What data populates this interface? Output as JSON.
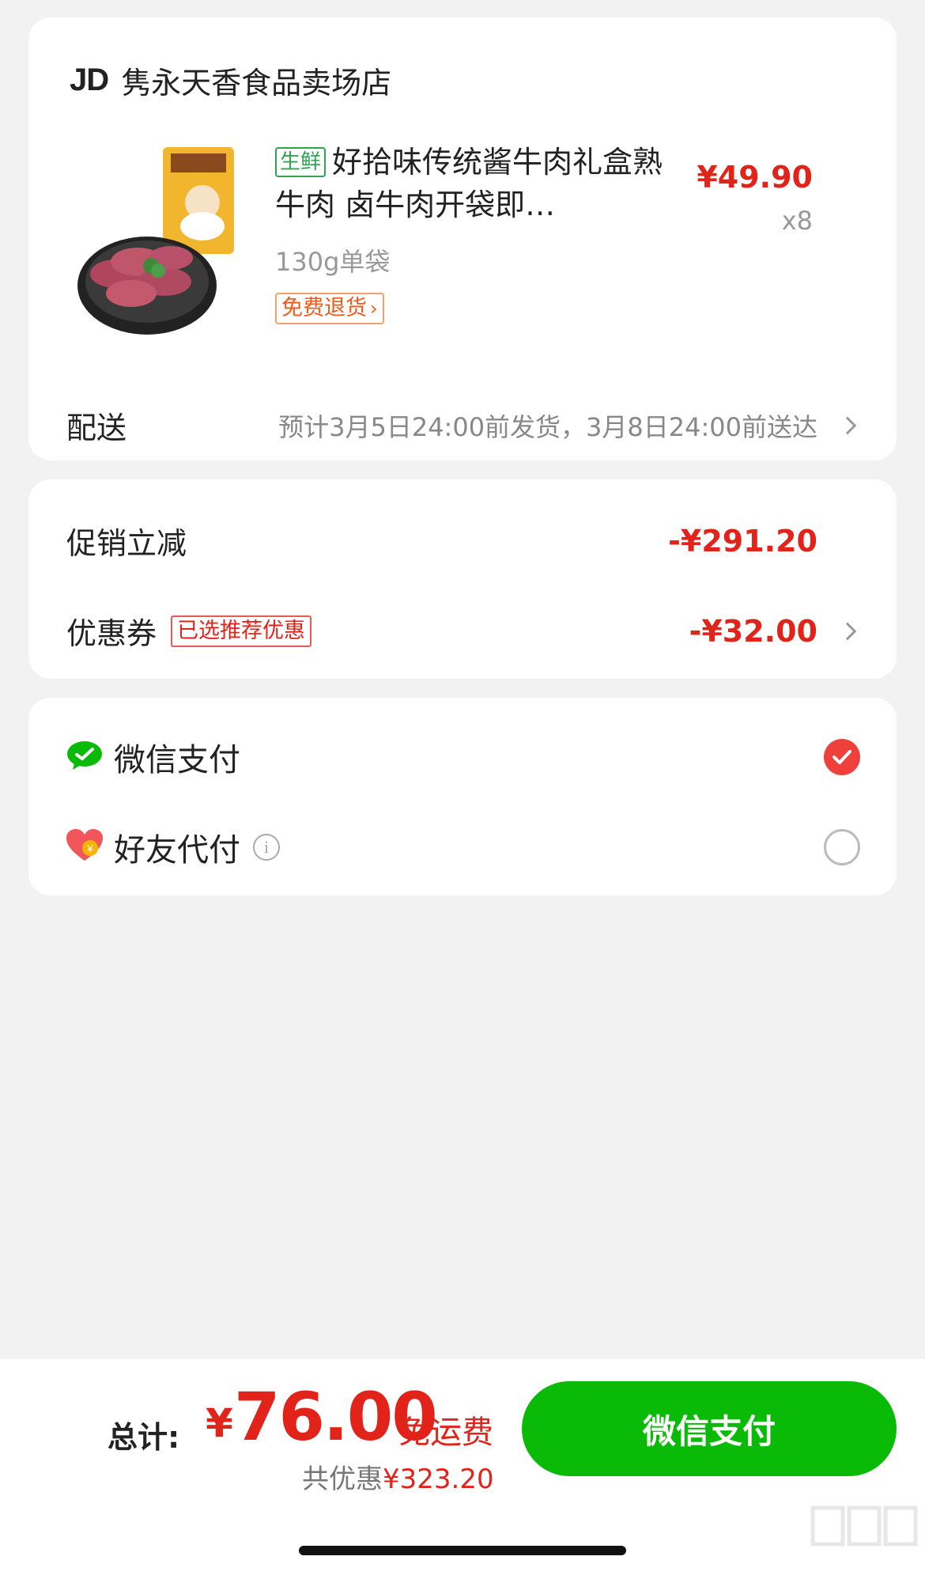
{
  "store": {
    "logo": "JD",
    "name": "隽永天香食品卖场店"
  },
  "product": {
    "tag": "生鲜",
    "title": "好拾味传统酱牛肉礼盒熟牛肉 卤牛肉开袋即…",
    "spec": "130g单袋",
    "return_tag": "免费退货",
    "price": "¥49.90",
    "quantity": "x8"
  },
  "delivery": {
    "label": "配送",
    "text": "预计3月5日24:00前发货，3月8日24:00前送达"
  },
  "discounts": {
    "promo_label": "促销立减",
    "promo_amount": "-¥291.20",
    "coupon_label": "优惠券",
    "coupon_tag": "已选推荐优惠",
    "coupon_amount": "-¥32.00"
  },
  "payment": {
    "wechat_label": "微信支付",
    "wechat_selected": true,
    "friend_label": "好友代付",
    "friend_selected": false
  },
  "footer": {
    "total_label": "总计:",
    "currency": "¥",
    "total_amount": "76.00",
    "free_shipping": "免运费",
    "saving_prefix": "共优惠",
    "saving_amount": "¥323.20",
    "pay_button": "微信支付"
  },
  "colors": {
    "price_red": "#e2231a",
    "wechat_green": "#09bb07",
    "fresh_green": "#2ea44f"
  }
}
